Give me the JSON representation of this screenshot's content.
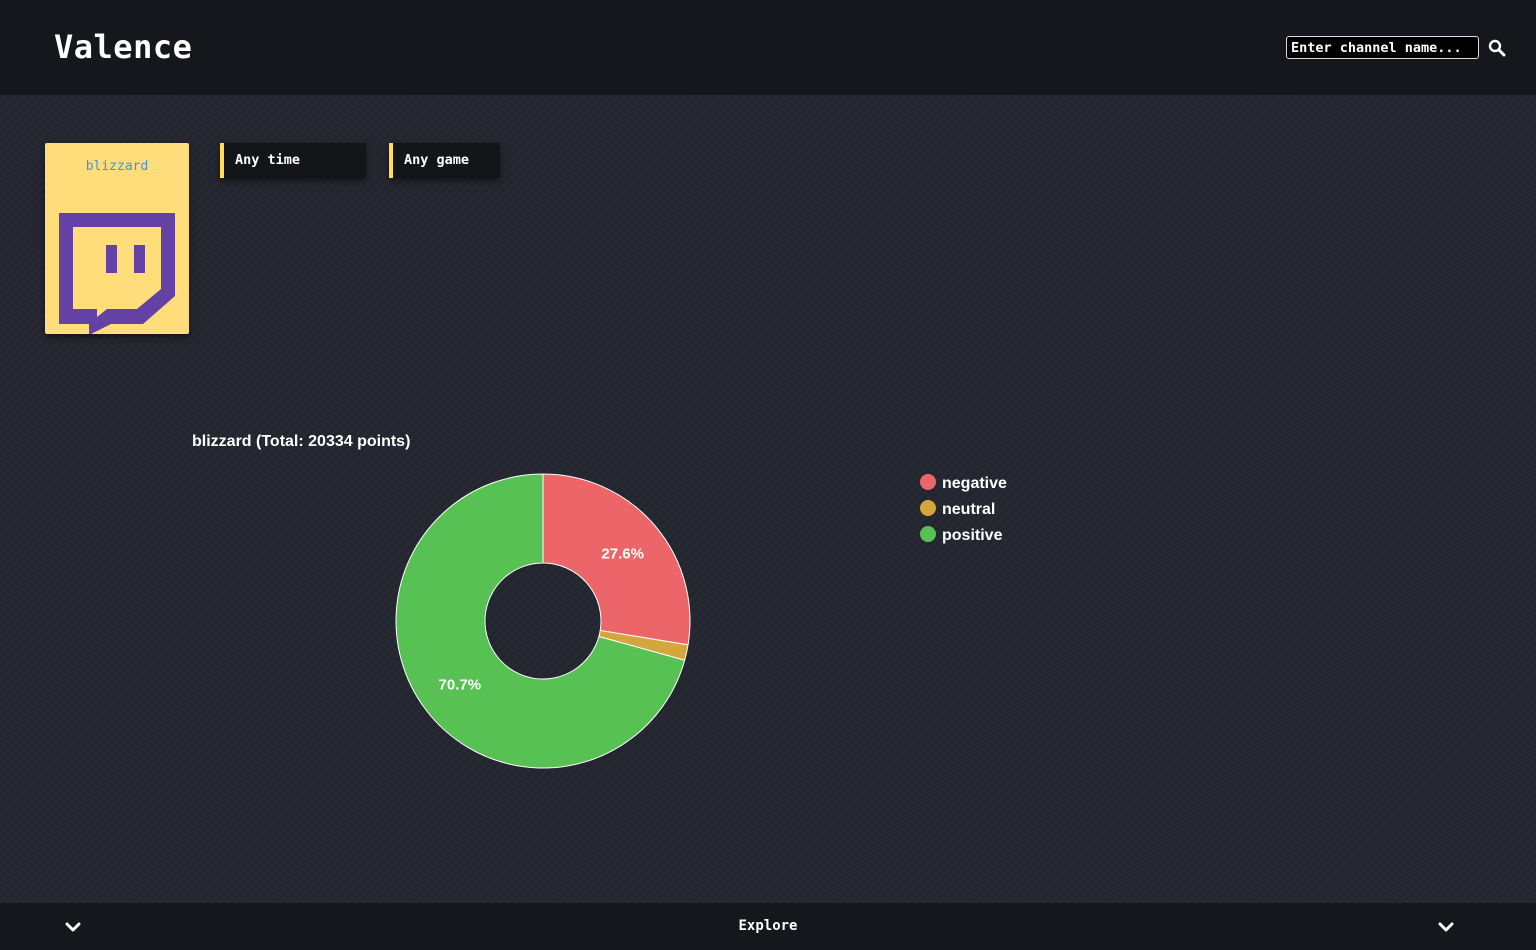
{
  "header": {
    "app_title": "Valence",
    "search_placeholder": "Enter channel name...",
    "search_icon": "search-icon"
  },
  "channel": {
    "name": "blizzard",
    "logo_icon": "twitch-logo-icon"
  },
  "filters": {
    "time_label": "Any time",
    "game_label": "Any game"
  },
  "chart_data": {
    "type": "pie",
    "donut": true,
    "title": "blizzard (Total: 20334 points)",
    "categories": [
      "negative",
      "neutral",
      "positive"
    ],
    "values": [
      27.6,
      1.7,
      70.7
    ],
    "value_labels": [
      "27.6%",
      "",
      "70.7%"
    ],
    "colors": [
      "#ec6669",
      "#d4a63b",
      "#57c154"
    ],
    "legend_position": "right",
    "total_points": 20334
  },
  "footer": {
    "explore_label": "Explore",
    "chevron_icon": "chevron-down-icon"
  },
  "colors": {
    "background": "#23262e",
    "bar": "#15171c",
    "accent": "#ffdd57",
    "twitch_purple": "#6441a5"
  }
}
